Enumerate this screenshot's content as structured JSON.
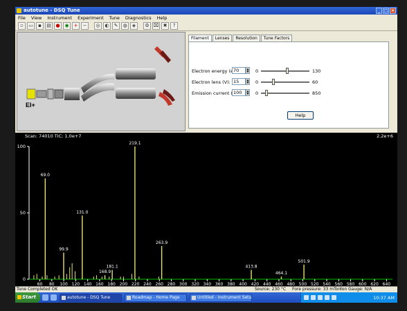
{
  "window": {
    "title": "autotune - DSQ Tune"
  },
  "menu": [
    "File",
    "View",
    "Instrument",
    "Experiment",
    "Tune",
    "Diagnostics",
    "Help"
  ],
  "schematic": {
    "source_label": "EI+"
  },
  "tabs": [
    "Filament",
    "Lenses",
    "Resolution",
    "Tune Factors"
  ],
  "params": [
    {
      "label": "Electron energy (eV):",
      "value": "70",
      "min": "0",
      "max": "130",
      "level": 0.54
    },
    {
      "label": "Electron lens (V):",
      "value": "15",
      "min": "0",
      "max": "60",
      "level": 0.25
    },
    {
      "label": "Emission current (uA):",
      "value": "100",
      "min": "0",
      "max": "850",
      "level": 0.12
    }
  ],
  "help_label": "Help",
  "spectrum": {
    "scan_info": "Scan: 74010  TIC: 1.0e+7",
    "scale_info": "2.2e+6"
  },
  "chart_data": {
    "type": "bar",
    "x": [
      69.0,
      99.9,
      131.0,
      168.9,
      181.1,
      219.1,
      263.9,
      413.8,
      464.1,
      501.9
    ],
    "values": [
      76,
      20,
      48,
      3,
      7,
      100,
      25,
      7,
      2,
      11
    ],
    "labels": [
      "69.0",
      "99.9",
      "131.0",
      "168.9",
      "181.1",
      "219.1",
      "263.9",
      "413.8",
      "464.1",
      "501.9"
    ],
    "minor_peaks": [
      {
        "x": 50,
        "y": 3
      },
      {
        "x": 55,
        "y": 4
      },
      {
        "x": 64,
        "y": 2
      },
      {
        "x": 72,
        "y": 3
      },
      {
        "x": 85,
        "y": 2
      },
      {
        "x": 92,
        "y": 3
      },
      {
        "x": 105,
        "y": 4
      },
      {
        "x": 110,
        "y": 9
      },
      {
        "x": 114,
        "y": 12
      },
      {
        "x": 119,
        "y": 6
      },
      {
        "x": 150,
        "y": 2
      },
      {
        "x": 155,
        "y": 3
      },
      {
        "x": 164,
        "y": 2
      },
      {
        "x": 176,
        "y": 2
      },
      {
        "x": 195,
        "y": 2
      },
      {
        "x": 200,
        "y": 2
      },
      {
        "x": 214,
        "y": 4
      },
      {
        "x": 226,
        "y": 2
      },
      {
        "x": 259,
        "y": 2
      },
      {
        "x": 414,
        "y": 1
      },
      {
        "x": 502,
        "y": 1
      }
    ],
    "yticks": [
      0,
      50,
      100
    ],
    "xticks": [
      60,
      80,
      100,
      120,
      140,
      160,
      180,
      200,
      220,
      240,
      260,
      280,
      300,
      320,
      340,
      360,
      380,
      400,
      420,
      440,
      460,
      480,
      500,
      520,
      540,
      560,
      580,
      600,
      620,
      640
    ],
    "xlim": [
      42,
      650
    ],
    "ylim": [
      0,
      100
    ],
    "colors": {
      "peak": "#e8e070",
      "axis": "#ffffff",
      "baseline": "#00c000"
    }
  },
  "status": {
    "message": "Tune Completed OK",
    "source": "Source:  230 °C",
    "pressure": "Fore pressure:  33 mTorr",
    "gauge": "Ion Gauge:  N/A"
  },
  "taskbar": {
    "start": "Start",
    "items": [
      "autotune - DSQ Tune",
      "Roadmap - Home Page",
      "Untitled - Instrument Setup"
    ],
    "clock": "10:37 AM"
  }
}
